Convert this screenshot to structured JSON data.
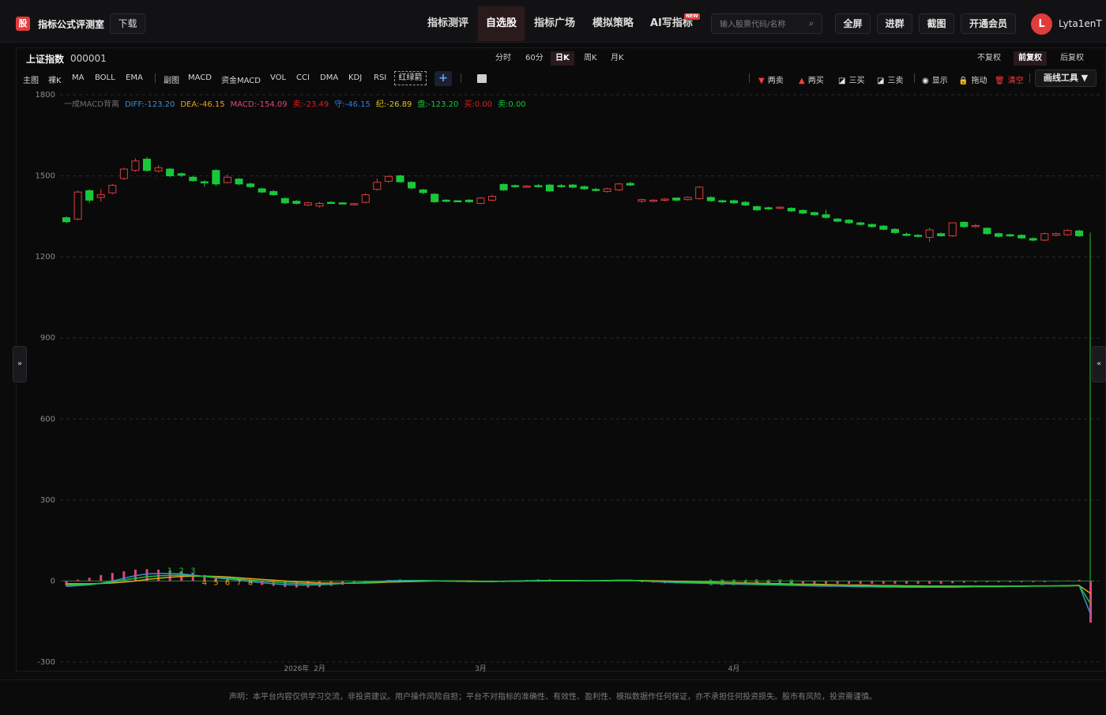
{
  "header": {
    "logo_char": "股",
    "brand": "指标公式评测室",
    "download_label": "下载",
    "nav": [
      "指标测评",
      "自选股",
      "指标广场",
      "模拟策略",
      "AI写指标"
    ],
    "nav_active": "自选股",
    "new_badge": "NEW",
    "search_placeholder": "输入股票代码/名称",
    "buttons": [
      "全屏",
      "进群",
      "截图",
      "开通会员"
    ],
    "avatar_letter": "L",
    "username": "Lyta1enT"
  },
  "symbol": {
    "name": "上证指数",
    "code": "000001"
  },
  "periods": [
    "分时",
    "60分",
    "日K",
    "周K",
    "月K"
  ],
  "period_active": "日K",
  "adjust_modes": [
    "不复权",
    "前复权",
    "后复权"
  ],
  "adjust_active": "前复权",
  "indicators_main": [
    "主图",
    "裸K",
    "MA",
    "BOLL",
    "EMA"
  ],
  "indicators_sub": [
    "副图",
    "MACD",
    "资金MACD",
    "VOL",
    "CCI",
    "DMA",
    "KDJ",
    "RSI"
  ],
  "indicator_selected": "红绿箭",
  "add_label": "+",
  "tools": [
    {
      "icon": "▼",
      "label": "两卖",
      "color": "#ff3b3b"
    },
    {
      "icon": "▲",
      "label": "两买",
      "color": "#ff3b3b"
    },
    {
      "icon": "◪",
      "label": "三买",
      "color": "#e6e6e6"
    },
    {
      "icon": "◪",
      "label": "三卖",
      "color": "#e6e6e6"
    },
    {
      "icon": "◉",
      "label": "显示",
      "color": "#e6e6e6"
    },
    {
      "icon": "🔒",
      "label": "拖动",
      "color": "#e6e6e6"
    },
    {
      "icon": "🗑",
      "label": "清空",
      "color": "#ff3b3b"
    }
  ],
  "draw_tool_label": "画线工具 ▼",
  "side_left": "»",
  "side_right": "«",
  "legend": [
    {
      "text": "一成MACD背离",
      "color": "#6f6f74"
    },
    {
      "text": "DIFF:-123.20",
      "color": "#3a8fd6"
    },
    {
      "text": "DEA:-46.15",
      "color": "#e8a317"
    },
    {
      "text": "MACD:-154.09",
      "color": "#e0457b"
    },
    {
      "text": "卖:-23.49",
      "color": "#e01e1e"
    },
    {
      "text": "守:-46.15",
      "color": "#2b7fe0"
    },
    {
      "text": "纪:-26.89",
      "color": "#e0c21e"
    },
    {
      "text": "盘:-123.20",
      "color": "#18c83a"
    },
    {
      "text": "买:0.00",
      "color": "#e01e1e"
    },
    {
      "text": "卖:0.00",
      "color": "#18c83a"
    }
  ],
  "axis": {
    "y_ticks": [
      "1800",
      "1500",
      "1200",
      "900",
      "600",
      "300",
      "0",
      "-300"
    ],
    "y_values": [
      1800,
      1500,
      1200,
      900,
      600,
      300,
      0,
      -300
    ],
    "x_labels": [
      {
        "text": "2026年",
        "i": 20
      },
      {
        "text": "2月",
        "i": 22
      },
      {
        "text": "3月",
        "i": 36
      },
      {
        "text": "4月",
        "i": 58
      }
    ]
  },
  "chart_data": {
    "type": "candlestick",
    "ylim": [
      -300,
      1800
    ],
    "candles": [
      [
        1330,
        1345,
        1325,
        1350,
        0
      ],
      [
        1340,
        1440,
        1335,
        1445,
        1
      ],
      [
        1445,
        1410,
        1400,
        1450,
        0
      ],
      [
        1420,
        1430,
        1405,
        1450,
        1
      ],
      [
        1437,
        1465,
        1432,
        1470,
        1
      ],
      [
        1490,
        1525,
        1485,
        1530,
        1
      ],
      [
        1520,
        1555,
        1515,
        1565,
        1
      ],
      [
        1562,
        1520,
        1515,
        1570,
        0
      ],
      [
        1518,
        1530,
        1512,
        1540,
        1
      ],
      [
        1525,
        1500,
        1495,
        1530,
        0
      ],
      [
        1508,
        1502,
        1496,
        1512,
        0
      ],
      [
        1495,
        1482,
        1478,
        1500,
        0
      ],
      [
        1478,
        1474,
        1460,
        1484,
        0
      ],
      [
        1520,
        1470,
        1462,
        1525,
        0
      ],
      [
        1475,
        1495,
        1472,
        1505,
        1
      ],
      [
        1488,
        1470,
        1465,
        1492,
        0
      ],
      [
        1470,
        1460,
        1455,
        1475,
        0
      ],
      [
        1452,
        1440,
        1436,
        1456,
        0
      ],
      [
        1442,
        1430,
        1426,
        1448,
        0
      ],
      [
        1416,
        1400,
        1396,
        1420,
        0
      ],
      [
        1406,
        1398,
        1394,
        1410,
        0
      ],
      [
        1392,
        1400,
        1388,
        1405,
        1
      ],
      [
        1388,
        1398,
        1382,
        1404,
        1
      ],
      [
        1400,
        1402,
        1396,
        1406,
        0
      ],
      [
        1400,
        1398,
        1395,
        1402,
        0
      ],
      [
        1394,
        1397,
        1390,
        1400,
        1
      ],
      [
        1402,
        1430,
        1398,
        1436,
        1
      ],
      [
        1450,
        1476,
        1445,
        1490,
        1
      ],
      [
        1480,
        1498,
        1474,
        1502,
        1
      ],
      [
        1500,
        1478,
        1474,
        1504,
        0
      ],
      [
        1476,
        1455,
        1450,
        1480,
        0
      ],
      [
        1448,
        1438,
        1432,
        1452,
        0
      ],
      [
        1432,
        1404,
        1400,
        1436,
        0
      ],
      [
        1410,
        1406,
        1402,
        1414,
        0
      ],
      [
        1408,
        1406,
        1402,
        1410,
        0
      ],
      [
        1410,
        1404,
        1400,
        1414,
        0
      ],
      [
        1398,
        1418,
        1395,
        1421,
        1
      ],
      [
        1410,
        1424,
        1406,
        1430,
        1
      ],
      [
        1468,
        1448,
        1444,
        1472,
        0
      ],
      [
        1464,
        1460,
        1456,
        1468,
        0
      ],
      [
        1460,
        1462,
        1456,
        1466,
        1
      ],
      [
        1464,
        1460,
        1456,
        1470,
        0
      ],
      [
        1466,
        1444,
        1440,
        1470,
        0
      ],
      [
        1464,
        1460,
        1456,
        1470,
        0
      ],
      [
        1466,
        1458,
        1454,
        1470,
        0
      ],
      [
        1460,
        1452,
        1448,
        1464,
        0
      ],
      [
        1450,
        1446,
        1442,
        1456,
        0
      ],
      [
        1442,
        1452,
        1438,
        1456,
        1
      ],
      [
        1448,
        1470,
        1444,
        1474,
        1
      ],
      [
        1472,
        1466,
        1462,
        1478,
        0
      ],
      [
        1406,
        1412,
        1400,
        1416,
        1
      ],
      [
        1406,
        1410,
        1402,
        1414,
        1
      ],
      [
        1410,
        1414,
        1406,
        1418,
        1
      ],
      [
        1418,
        1410,
        1406,
        1420,
        0
      ],
      [
        1412,
        1420,
        1408,
        1424,
        1
      ],
      [
        1416,
        1458,
        1412,
        1462,
        1
      ],
      [
        1420,
        1408,
        1404,
        1424,
        0
      ],
      [
        1408,
        1404,
        1400,
        1412,
        0
      ],
      [
        1408,
        1400,
        1396,
        1412,
        0
      ],
      [
        1402,
        1392,
        1388,
        1406,
        0
      ],
      [
        1386,
        1374,
        1370,
        1390,
        0
      ],
      [
        1382,
        1378,
        1374,
        1386,
        0
      ],
      [
        1384,
        1380,
        1376,
        1388,
        1
      ],
      [
        1380,
        1370,
        1366,
        1384,
        0
      ],
      [
        1372,
        1362,
        1358,
        1376,
        0
      ],
      [
        1364,
        1356,
        1352,
        1368,
        0
      ],
      [
        1356,
        1346,
        1342,
        1374,
        0
      ],
      [
        1340,
        1332,
        1328,
        1344,
        0
      ],
      [
        1336,
        1326,
        1322,
        1340,
        0
      ],
      [
        1326,
        1320,
        1316,
        1330,
        0
      ],
      [
        1320,
        1312,
        1308,
        1324,
        0
      ],
      [
        1314,
        1302,
        1298,
        1318,
        0
      ],
      [
        1302,
        1290,
        1286,
        1306,
        0
      ],
      [
        1284,
        1282,
        1276,
        1290,
        0
      ],
      [
        1280,
        1276,
        1272,
        1284,
        0
      ],
      [
        1272,
        1300,
        1256,
        1308,
        1
      ],
      [
        1286,
        1278,
        1274,
        1290,
        0
      ],
      [
        1278,
        1326,
        1274,
        1328,
        1
      ],
      [
        1328,
        1312,
        1308,
        1332,
        0
      ],
      [
        1316,
        1312,
        1308,
        1322,
        1
      ],
      [
        1306,
        1286,
        1282,
        1310,
        0
      ],
      [
        1286,
        1276,
        1272,
        1290,
        0
      ],
      [
        1282,
        1278,
        1274,
        1286,
        0
      ],
      [
        1280,
        1270,
        1266,
        1284,
        0
      ],
      [
        1268,
        1262,
        1258,
        1272,
        0
      ],
      [
        1262,
        1286,
        1258,
        1290,
        1
      ],
      [
        1280,
        1286,
        1276,
        1290,
        1
      ],
      [
        1282,
        1298,
        1278,
        1302,
        1
      ],
      [
        1296,
        1278,
        1274,
        1300,
        0
      ]
    ],
    "macd_bars": [
      -18,
      5,
      12,
      22,
      30,
      36,
      42,
      44,
      42,
      40,
      36,
      30,
      22,
      14,
      6,
      -2,
      -8,
      -14,
      -18,
      -22,
      -24,
      -24,
      -22,
      -18,
      -14,
      -10,
      -6,
      -2,
      4,
      6,
      4,
      2,
      0,
      -2,
      -4,
      -4,
      -4,
      -4,
      -4,
      2,
      4,
      6,
      6,
      4,
      2,
      2,
      2,
      2,
      4,
      2,
      -4,
      -6,
      -8,
      -8,
      -8,
      -10,
      -10,
      -10,
      -10,
      -10,
      -10,
      -10,
      -10,
      -10,
      -10,
      -10,
      -10,
      -10,
      -10,
      -10,
      -10,
      -10,
      -10,
      -10,
      -10,
      -10,
      -10,
      -8,
      -6,
      -4,
      -4,
      -4,
      -4,
      -4,
      -4,
      -4,
      -2,
      2,
      4,
      -154
    ],
    "diff": [
      -20,
      -17,
      -14,
      -8,
      0,
      10,
      20,
      26,
      28,
      28,
      26,
      22,
      17,
      12,
      8,
      3,
      -2,
      -6,
      -10,
      -13,
      -15,
      -15,
      -14,
      -12,
      -9,
      -6,
      -4,
      -2,
      1,
      2,
      2,
      2,
      1,
      0,
      -1,
      -2,
      -2,
      -2,
      -1,
      0,
      1,
      2,
      2,
      2,
      2,
      1,
      1,
      2,
      3,
      3,
      0,
      -2,
      -4,
      -6,
      -7,
      -8,
      -9,
      -10,
      -11,
      -12,
      -13,
      -14,
      -15,
      -16,
      -17,
      -18,
      -19,
      -19,
      -20,
      -21,
      -21,
      -22,
      -22,
      -23,
      -23,
      -23,
      -23,
      -23,
      -22,
      -21,
      -21,
      -21,
      -20,
      -20,
      -19,
      -19,
      -18,
      -17,
      -16,
      -123
    ],
    "dea": [
      -10,
      -10,
      -10,
      -9,
      -7,
      -4,
      0,
      6,
      10,
      14,
      17,
      18,
      18,
      17,
      15,
      12,
      9,
      6,
      3,
      0,
      -3,
      -5,
      -7,
      -8,
      -8,
      -8,
      -7,
      -6,
      -4,
      -3,
      -2,
      -1,
      0,
      0,
      0,
      0,
      -1,
      -1,
      -1,
      -1,
      0,
      0,
      1,
      1,
      1,
      1,
      1,
      1,
      2,
      2,
      2,
      1,
      0,
      -1,
      -2,
      -3,
      -4,
      -5,
      -6,
      -7,
      -8,
      -9,
      -10,
      -11,
      -12,
      -12,
      -13,
      -14,
      -15,
      -15,
      -16,
      -17,
      -17,
      -18,
      -18,
      -19,
      -19,
      -19,
      -19,
      -19,
      -19,
      -19,
      -19,
      -19,
      -18,
      -18,
      -18,
      -18,
      -17,
      -46
    ],
    "marks_top": [
      [
        9,
        "1"
      ],
      [
        10,
        "2"
      ],
      [
        11,
        "3"
      ]
    ],
    "marks_low": [
      [
        12,
        "4"
      ],
      [
        13,
        "5"
      ],
      [
        14,
        "6"
      ],
      [
        15,
        "7"
      ],
      [
        16,
        "8"
      ],
      [
        17,
        "9"
      ],
      [
        56,
        "1"
      ],
      [
        57,
        "2"
      ],
      [
        58,
        "3"
      ],
      [
        59,
        "4"
      ],
      [
        60,
        "5"
      ],
      [
        61,
        "6"
      ],
      [
        62,
        "7"
      ],
      [
        63,
        "8"
      ]
    ]
  },
  "footer": "声明：本平台内容仅供学习交流，非投资建议。用户操作风险自担；平台不对指标的准确性、有效性、盈利性、模拟数据作任何保证，亦不承担任何投资损失。股市有风险，投资需谨慎。"
}
